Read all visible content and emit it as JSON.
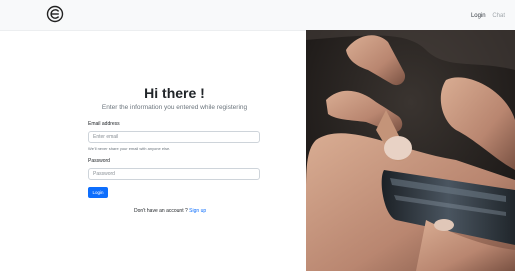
{
  "navbar": {
    "logo_icon": "circle-e-logo",
    "links": {
      "login": "Login",
      "chat": "Chat"
    }
  },
  "form": {
    "title": "Hi there !",
    "subtitle": "Enter the information you entered while registering",
    "email": {
      "label": "Email address",
      "placeholder": "Enter email",
      "help": "We'll never share your email with anyone else."
    },
    "password": {
      "label": "Password",
      "placeholder": "Password"
    },
    "login_button": "Login",
    "signup_prompt": "Don't have an account ?",
    "signup_link": "Sign up"
  },
  "colors": {
    "primary": "#0d6efd",
    "navbar_bg": "#f8f9fa",
    "text": "#212529"
  },
  "hero_image": {
    "icon": "hand-holding-phone-photo"
  }
}
